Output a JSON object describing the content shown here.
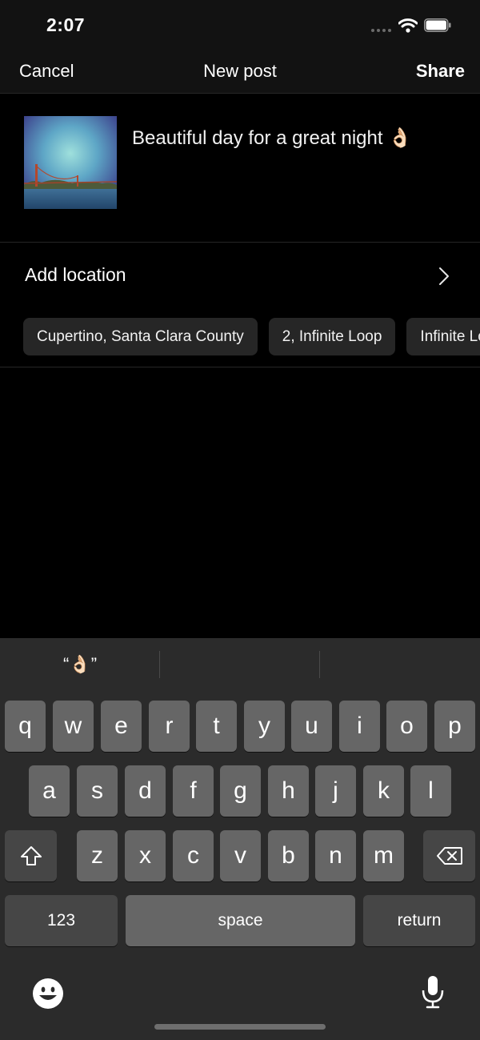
{
  "status": {
    "time": "2:07"
  },
  "nav": {
    "cancel": "Cancel",
    "title": "New post",
    "share": "Share"
  },
  "post": {
    "caption": "Beautiful day for a great night 👌🏻"
  },
  "location": {
    "label": "Add location",
    "suggestions": [
      "Cupertino, Santa Clara County",
      "2, Infinite Loop",
      "Infinite Loop"
    ]
  },
  "keyboard": {
    "suggestion_left": "“👌🏻”",
    "row1": [
      "q",
      "w",
      "e",
      "r",
      "t",
      "y",
      "u",
      "i",
      "o",
      "p"
    ],
    "row2": [
      "a",
      "s",
      "d",
      "f",
      "g",
      "h",
      "j",
      "k",
      "l"
    ],
    "row3": [
      "z",
      "x",
      "c",
      "v",
      "b",
      "n",
      "m"
    ],
    "numbers": "123",
    "space": "space",
    "return": "return"
  },
  "colors": {
    "background": "#000000",
    "bar": "#121212",
    "chip": "#262626",
    "keyboard": "#2b2b2b",
    "key": "#666666",
    "key_dark": "#464646"
  }
}
